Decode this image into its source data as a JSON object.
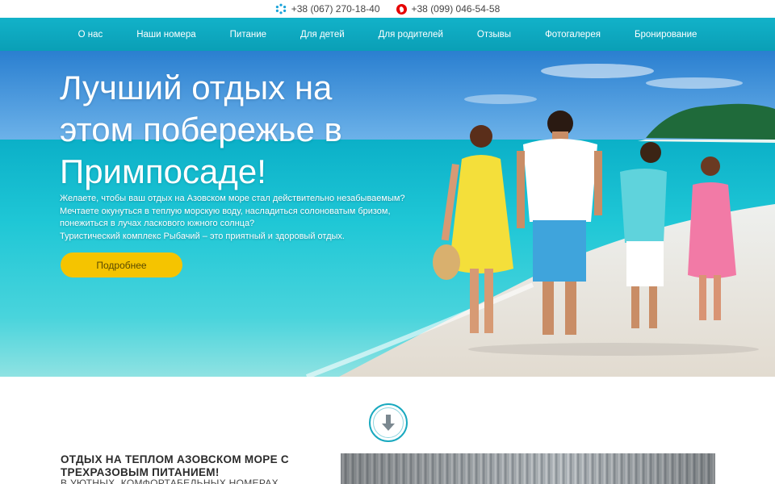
{
  "topbar": {
    "phones": [
      {
        "icon": "kyivstar-icon",
        "number": "+38 (067) 270-18-40"
      },
      {
        "icon": "vodafone-icon",
        "number": "+38 (099) 046-54-58"
      }
    ]
  },
  "nav": {
    "items": [
      "О нас",
      "Наши номера",
      "Питание",
      "Для детей",
      "Для родителей",
      "Отзывы",
      "Фотогалерея",
      "Бронирование"
    ]
  },
  "hero": {
    "title_lines": [
      "Лучший отдых на",
      "этом побережье в",
      "Примпосаде!"
    ],
    "text_lines": [
      "Желаете, чтобы ваш отдых на Азовском море стал действительно незабываемым?",
      "Мечтаете окунуться в теплую морскую воду, насладиться солоноватым бризом,",
      "понежиться в лучах ласкового южного солнца?",
      "Туристический комплекс Рыбачий – это приятный и здоровый отдых."
    ],
    "button_label": "Подробнее"
  },
  "section": {
    "title_lines": [
      "ОТДЫХ НА ТЕПЛОМ АЗОВСКОМ МОРЕ С",
      "ТРЕХРАЗОВЫМ ПИТАНИЕМ!"
    ],
    "subtitle": "В УЮТНЫХ, КОМФОРТАБЕЛЬНЫХ НОМЕРАХ"
  },
  "colors": {
    "nav": "#0fa9c0",
    "button": "#f5c400",
    "accent": "#19a9bf"
  }
}
